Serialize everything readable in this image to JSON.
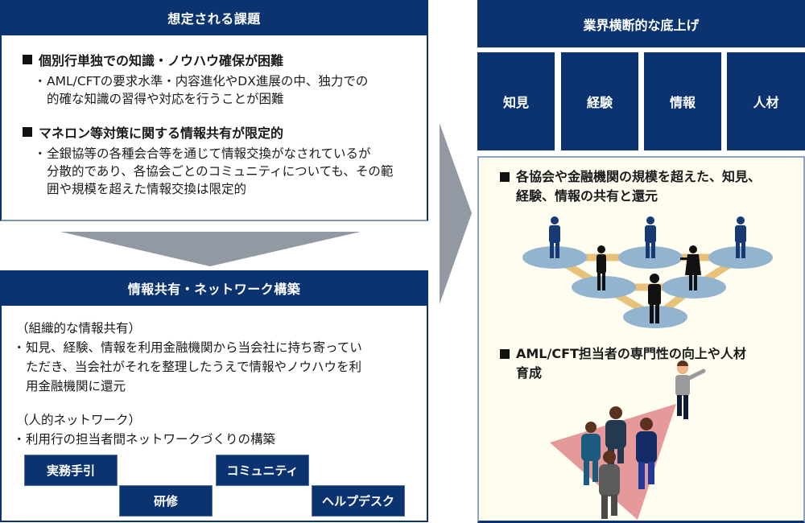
{
  "issues": {
    "header": "想定される課題",
    "items": [
      {
        "title": "個別行単独での知識・ノウハウ確保が困難",
        "bullets": [
          {
            "marker": "・",
            "lines": [
              "AML/CFTの要求水準・内容進化やDX進展の中、独力での",
              "的確な知識の習得や対応を行うことが困難"
            ]
          }
        ]
      },
      {
        "title": "マネロン等対策に関する情報共有が限定的",
        "bullets": [
          {
            "marker": "・",
            "lines": [
              "全銀協等の各種会合等を通じて情報交換がなされているが",
              "分散的であり、各協会ごとのコミュニティについても、その範",
              "囲や規模を超えた情報交換は限定的"
            ]
          }
        ]
      }
    ]
  },
  "network": {
    "header": "情報共有・ネットワーク構築",
    "sections": [
      {
        "label": "（組織的な情報共有）",
        "marker": "・",
        "lines": [
          "知見、経験、情報を利用金融機関から当会社に持ち寄ってい",
          "ただき、当会社がそれを整理したうえで情報やノウハウを利",
          "用金融機関に還元"
        ]
      },
      {
        "label": "（人的ネットワーク）",
        "marker": "・",
        "lines": [
          "利用行の担当者間ネットワークづくりの構築"
        ]
      }
    ],
    "tiles": [
      "実務手引",
      "研修",
      "コミュニティ",
      "ヘルプデスク"
    ]
  },
  "uplift": {
    "header": "業界横断的な底上げ",
    "pillars": [
      "知見",
      "経験",
      "情報",
      "人材"
    ]
  },
  "benefits": {
    "items": [
      {
        "lines": [
          "各協会や金融機関の規模を超えた、知見、",
          "経験、情報の共有と還元"
        ],
        "illustration": "network-of-people"
      },
      {
        "lines": [
          "AML/CFT担当者の専門性の向上や人材",
          "育成"
        ],
        "illustration": "leader-guiding-team"
      }
    ]
  },
  "colors": {
    "navy": "#0b3370",
    "arrow_gray": "#9299a2",
    "panel_cream": "#fffdf0",
    "node_blue": "#93b4cf",
    "link_gold": "#e8c27a",
    "spotlight_pink": "#e5999b"
  }
}
